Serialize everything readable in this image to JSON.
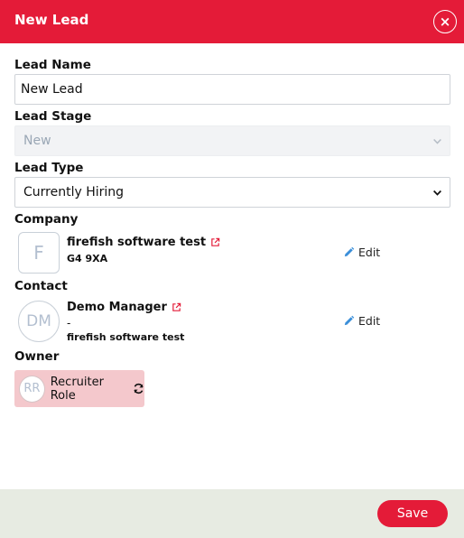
{
  "modal": {
    "title": "New Lead"
  },
  "icons": {
    "close": "close-icon",
    "chevron": "chevron-down-icon",
    "external_link": "external-link-icon",
    "edit": "pencil-icon",
    "refresh": "refresh-icon"
  },
  "colors": {
    "brand": "#e41b38",
    "owner_chip": "#f4c8cc",
    "footer": "#e7ebe2",
    "edit_icon": "#3b8fd9"
  },
  "fields": {
    "lead_name": {
      "label": "Lead Name",
      "value": "New Lead"
    },
    "lead_stage": {
      "label": "Lead Stage",
      "value": "New"
    },
    "lead_type": {
      "label": "Lead Type",
      "value": "Currently Hiring"
    }
  },
  "company": {
    "label": "Company",
    "initials": "F",
    "name": "firefish software test",
    "postcode": "G4 9XA",
    "edit_label": "Edit"
  },
  "contact": {
    "label": "Contact",
    "initials": "DM",
    "name": "Demo Manager",
    "title": "-",
    "company": "firefish software test",
    "edit_label": "Edit"
  },
  "owner": {
    "label": "Owner",
    "initials": "RR",
    "name": "Recruiter Role"
  },
  "footer": {
    "save_label": "Save"
  }
}
